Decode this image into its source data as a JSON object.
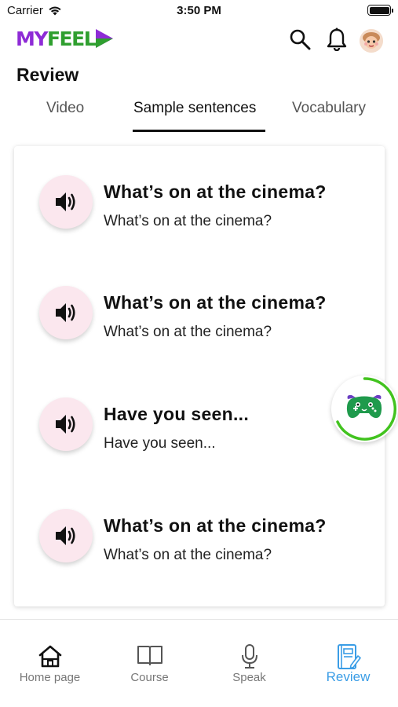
{
  "status_bar": {
    "carrier": "Carrier",
    "time": "3:50 PM"
  },
  "header": {
    "logo_my": "MY",
    "logo_feel": "FEEL"
  },
  "page_title": "Review",
  "tabs": [
    {
      "label": "Video",
      "active": false
    },
    {
      "label": "Sample sentences",
      "active": true
    },
    {
      "label": "Vocabulary",
      "active": false
    }
  ],
  "sentences": [
    {
      "text": "What’s on at the cinema?",
      "translation": "What’s on at the cinema?"
    },
    {
      "text": "What’s on at the cinema?",
      "translation": "What’s on at the cinema?"
    },
    {
      "text": "Have you seen...",
      "translation": "Have you seen..."
    },
    {
      "text": "What’s on at the cinema?",
      "translation": "What’s on at the cinema?"
    }
  ],
  "bottom_nav": [
    {
      "label": "Home page",
      "icon": "home-icon",
      "active": false
    },
    {
      "label": "Course",
      "icon": "book-icon",
      "active": false
    },
    {
      "label": "Speak",
      "icon": "microphone-icon",
      "active": false
    },
    {
      "label": "Review",
      "icon": "notebook-icon",
      "active": true
    }
  ],
  "colors": {
    "accent": "#3a9de6",
    "logo_purple": "#8e2bd6",
    "logo_green": "#2f9f2f",
    "speaker_bg": "#fbe7ee",
    "progress_ring": "#42c31f"
  }
}
